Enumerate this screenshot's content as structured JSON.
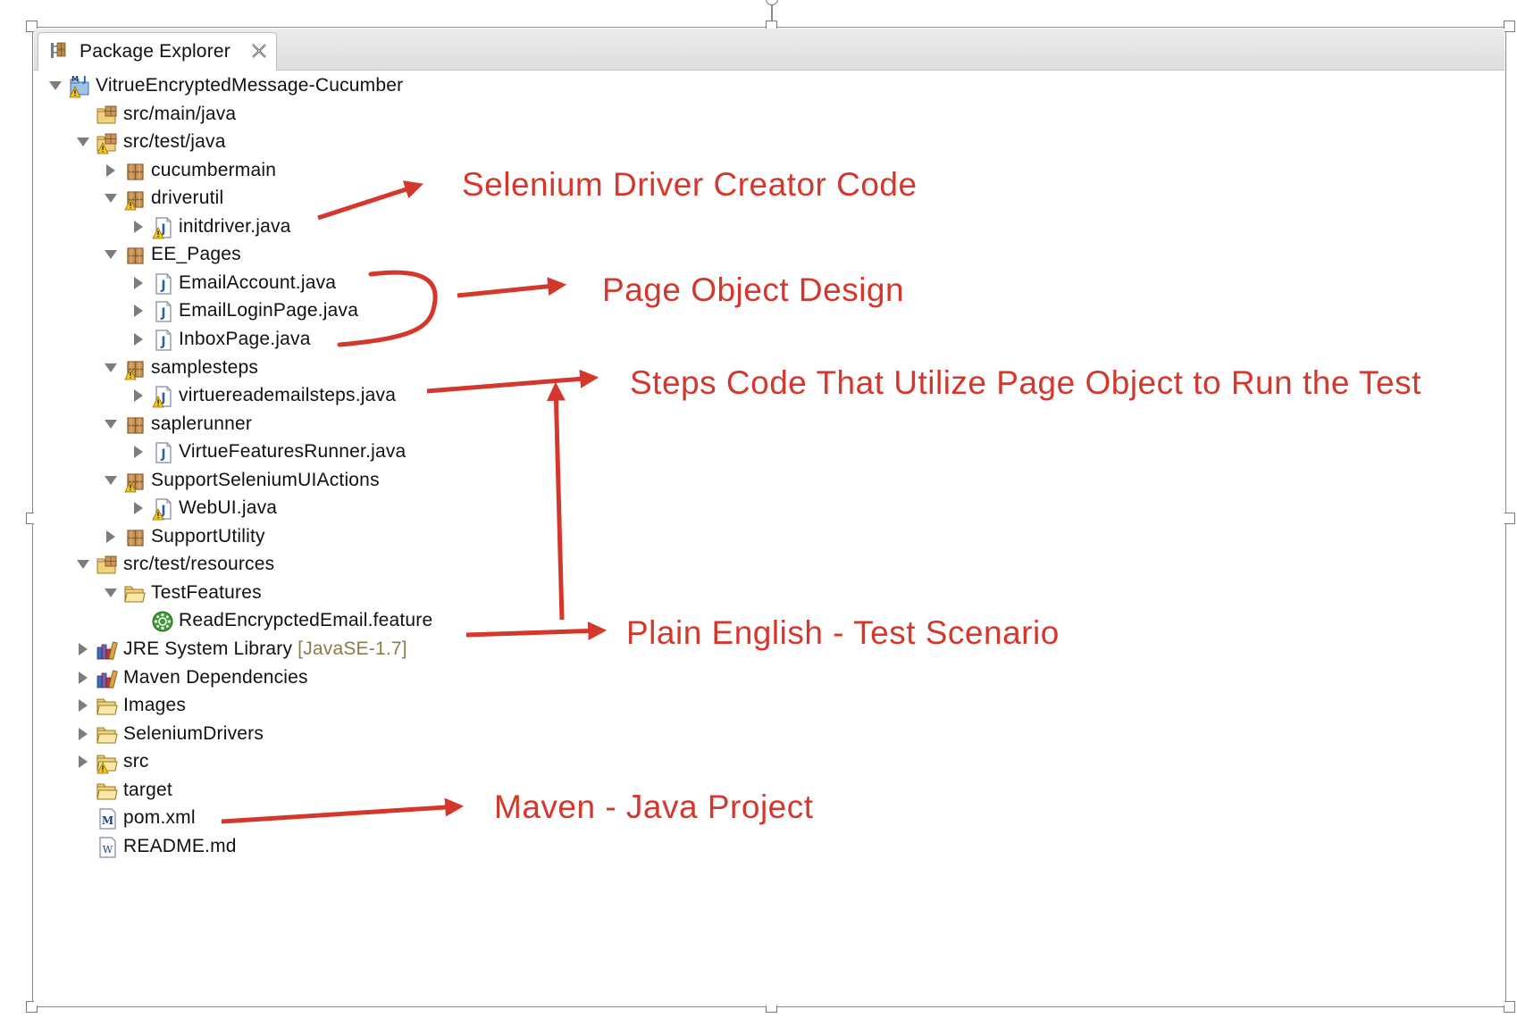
{
  "view": {
    "tab_title": "Package Explorer"
  },
  "tree": [
    {
      "label": "VitrueEncryptedMessage-Cucumber",
      "level": 0,
      "twisty": "expanded",
      "icon": "maven-project-icon",
      "warn": true
    },
    {
      "label": "src/main/java",
      "level": 1,
      "twisty": "none",
      "icon": "source-folder-icon",
      "warn": false
    },
    {
      "label": "src/test/java",
      "level": 1,
      "twisty": "expanded",
      "icon": "source-folder-icon",
      "warn": true
    },
    {
      "label": "cucumbermain",
      "level": 2,
      "twisty": "collapsed",
      "icon": "package-icon",
      "warn": false
    },
    {
      "label": "driverutil",
      "level": 2,
      "twisty": "expanded",
      "icon": "package-icon",
      "warn": true
    },
    {
      "label": "initdriver.java",
      "level": 3,
      "twisty": "collapsed",
      "icon": "java-file-icon",
      "warn": true
    },
    {
      "label": "EE_Pages",
      "level": 2,
      "twisty": "expanded",
      "icon": "package-icon",
      "warn": false
    },
    {
      "label": "EmailAccount.java",
      "level": 3,
      "twisty": "collapsed",
      "icon": "java-file-icon",
      "warn": false
    },
    {
      "label": "EmailLoginPage.java",
      "level": 3,
      "twisty": "collapsed",
      "icon": "java-file-icon",
      "warn": false
    },
    {
      "label": "InboxPage.java",
      "level": 3,
      "twisty": "collapsed",
      "icon": "java-file-icon",
      "warn": false
    },
    {
      "label": "samplesteps",
      "level": 2,
      "twisty": "expanded",
      "icon": "package-icon",
      "warn": true
    },
    {
      "label": "virtuereademailsteps.java",
      "level": 3,
      "twisty": "collapsed",
      "icon": "java-file-icon",
      "warn": true
    },
    {
      "label": "saplerunner",
      "level": 2,
      "twisty": "expanded",
      "icon": "package-icon",
      "warn": false
    },
    {
      "label": "VirtueFeaturesRunner.java",
      "level": 3,
      "twisty": "collapsed",
      "icon": "java-file-icon",
      "warn": false
    },
    {
      "label": "SupportSeleniumUIActions",
      "level": 2,
      "twisty": "expanded",
      "icon": "package-icon",
      "warn": true
    },
    {
      "label": "WebUI.java",
      "level": 3,
      "twisty": "collapsed",
      "icon": "java-file-icon",
      "warn": true
    },
    {
      "label": "SupportUtility",
      "level": 2,
      "twisty": "collapsed",
      "icon": "package-icon",
      "warn": false
    },
    {
      "label": "src/test/resources",
      "level": 1,
      "twisty": "expanded",
      "icon": "source-folder-icon",
      "warn": false
    },
    {
      "label": "TestFeatures",
      "level": 2,
      "twisty": "expanded",
      "icon": "folder-icon",
      "warn": false
    },
    {
      "label": "ReadEncrypctedEmail.feature",
      "level": 3,
      "twisty": "none",
      "icon": "cucumber-feature-icon",
      "warn": false
    },
    {
      "label": "JRE System Library",
      "suffix": "[JavaSE-1.7]",
      "level": 1,
      "twisty": "collapsed",
      "icon": "library-icon",
      "warn": false
    },
    {
      "label": "Maven Dependencies",
      "level": 1,
      "twisty": "collapsed",
      "icon": "library-icon",
      "warn": false
    },
    {
      "label": "Images",
      "level": 1,
      "twisty": "collapsed",
      "icon": "folder-icon",
      "warn": false
    },
    {
      "label": "SeleniumDrivers",
      "level": 1,
      "twisty": "collapsed",
      "icon": "folder-icon",
      "warn": false
    },
    {
      "label": "src",
      "level": 1,
      "twisty": "collapsed",
      "icon": "folder-icon",
      "warn": true
    },
    {
      "label": "target",
      "level": 1,
      "twisty": "none",
      "icon": "folder-icon",
      "warn": false
    },
    {
      "label": "pom.xml",
      "level": 1,
      "twisty": "none",
      "icon": "maven-pom-icon",
      "warn": false
    },
    {
      "label": "README.md",
      "level": 1,
      "twisty": "none",
      "icon": "markdown-file-icon",
      "warn": false
    }
  ],
  "annotations": {
    "driver_creator": "Selenium Driver Creator Code",
    "page_object": "Page Object Design",
    "steps_code": "Steps Code That Utilize Page Object to Run the Test",
    "plain_english": "Plain English - Test Scenario",
    "maven_project": "Maven - Java Project"
  },
  "colors": {
    "annotation": "#d4382c",
    "library_suffix": "#8b7b4a",
    "package_brown": "#8a5a2b",
    "folder_yellow": "#f2d27a",
    "java_blue": "#2d5fa8",
    "cucumber_green": "#3f9b3a",
    "warning_yellow": "#f5c518"
  }
}
